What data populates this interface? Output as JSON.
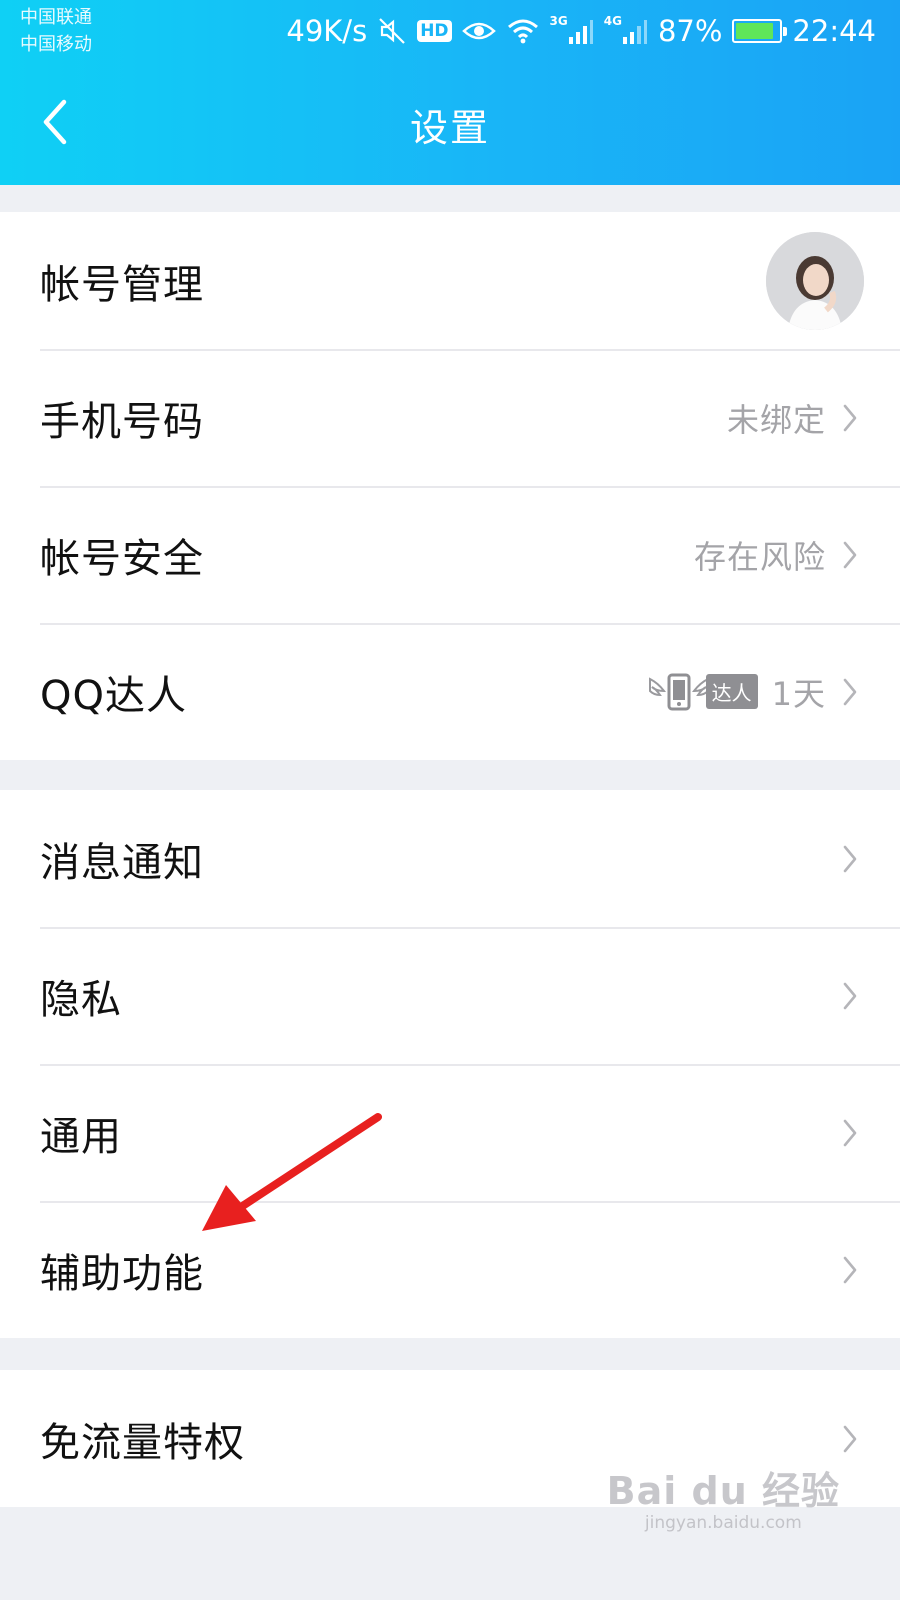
{
  "status_bar": {
    "carrier_1": "中国联通",
    "carrier_2": "中国移动",
    "speed": "49K/s",
    "hd_label": "HD",
    "sim1_network": "3G",
    "sim2_network": "4G",
    "battery_percent": "87%",
    "battery_level": 0.87,
    "time": "22:44",
    "icons": [
      "mute-icon",
      "hd-icon",
      "eye-comfort-icon",
      "wifi-icon",
      "signal-icon",
      "signal-icon",
      "battery-charging-icon"
    ]
  },
  "header": {
    "title": "设置",
    "back_icon": "chevron-left-icon"
  },
  "groups": [
    {
      "items": [
        {
          "label": "帐号管理",
          "right": "avatar"
        },
        {
          "label": "手机号码",
          "value": "未绑定"
        },
        {
          "label": "帐号安全",
          "value": "存在风险"
        },
        {
          "label": "QQ达人",
          "badge": "达人",
          "value": "1天"
        }
      ]
    },
    {
      "items": [
        {
          "label": "消息通知"
        },
        {
          "label": "隐私"
        },
        {
          "label": "通用"
        },
        {
          "label": "辅助功能"
        }
      ]
    },
    {
      "items": [
        {
          "label": "免流量特权"
        }
      ]
    }
  ],
  "annotation": {
    "arrow_color": "#e8201f",
    "points_to": "辅助功能"
  },
  "watermark": {
    "logo": "Bai du 经验",
    "url": "jingyan.baidu.com"
  },
  "colors": {
    "header_start": "#0fd0f5",
    "header_end": "#1aa3f5",
    "background": "#eef0f4",
    "value_text": "#a4a4a8"
  }
}
